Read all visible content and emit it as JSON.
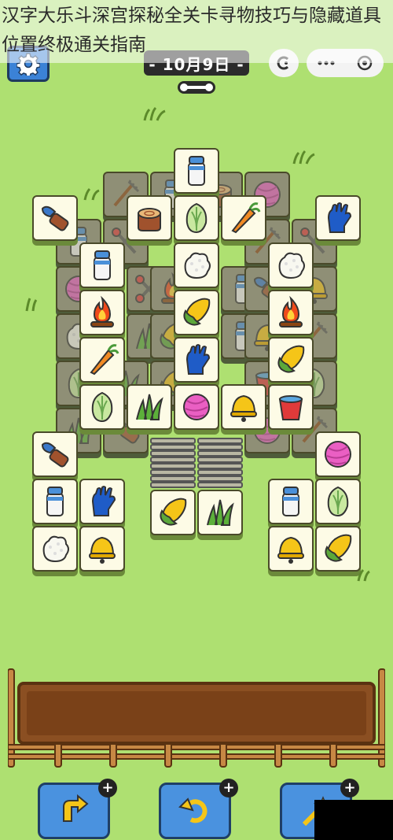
{
  "overlay": {
    "title": "汉字大乐斗深宫探秘全关卡寻物技巧与隐藏道具位置终极通关指南"
  },
  "header": {
    "date_label": "- 10月9日 -",
    "icons": {
      "settings": "gear-icon",
      "timer": "bone-icon",
      "mini": "c-icon",
      "more": "more-icon",
      "target": "target-icon"
    }
  },
  "board": {
    "tile_types": [
      "milk",
      "brush",
      "stump",
      "cabbage",
      "carrot",
      "glove",
      "rice",
      "campfire",
      "corn",
      "grass",
      "yarn",
      "bell",
      "bucket",
      "rake",
      "scissors"
    ]
  },
  "toolbar": {
    "buttons": [
      {
        "icon": "shuffle-icon",
        "badge": "+"
      },
      {
        "icon": "undo-icon",
        "badge": "+"
      },
      {
        "icon": "wand-icon",
        "badge": "+"
      }
    ]
  },
  "colors": {
    "background": "#aee071",
    "tile_face": "#fdfbe6",
    "tile_border": "#4a4a2a",
    "tray": "#8b4f22",
    "button": "#4a92df"
  }
}
